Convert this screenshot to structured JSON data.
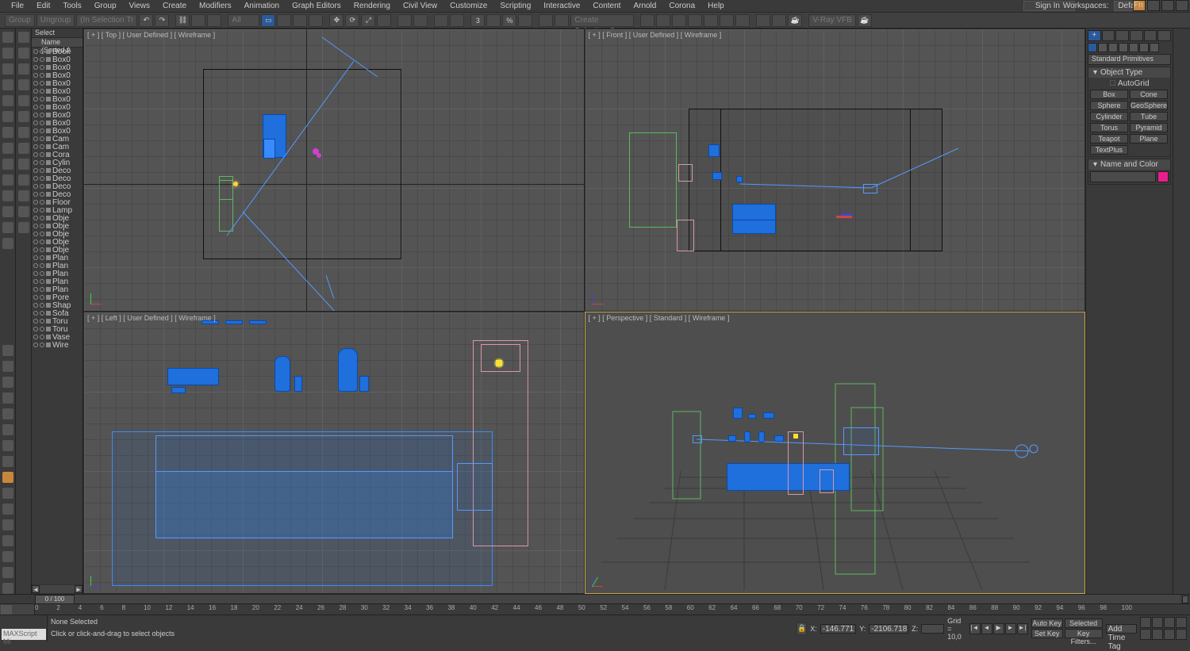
{
  "menu": {
    "items": [
      "File",
      "Edit",
      "Tools",
      "Group",
      "Views",
      "Create",
      "Modifiers",
      "Animation",
      "Graph Editors",
      "Rendering",
      "Civil View",
      "Customize",
      "Scripting",
      "Interactive",
      "Content",
      "Arnold",
      "Corona",
      "Help"
    ],
    "sign_in": "Sign In",
    "workspaces_label": "Workspaces:",
    "workspaces_value": "Default"
  },
  "toolbar": {
    "group": "Group",
    "ungroup": "Ungroup",
    "sel_hint": "(In Selection Tr",
    "all": "All",
    "create_set": "Create Selection Se",
    "vray": "V-Ray VFB"
  },
  "scene": {
    "head": "Select",
    "cols": "Name (Sorted A",
    "items": [
      "Book",
      "Box0",
      "Box0",
      "Box0",
      "Box0",
      "Box0",
      "Box0",
      "Box0",
      "Box0",
      "Box0",
      "Box0",
      "Cam",
      "Cam",
      "Cora",
      "Cylin",
      "Deco",
      "Deco",
      "Deco",
      "Deco",
      "Floor",
      "Lamp",
      "Obje",
      "Obje",
      "Obje",
      "Obje",
      "Obje",
      "Plan",
      "Plan",
      "Plan",
      "Plan",
      "Plan",
      "Pore",
      "Shap",
      "Sofa",
      "Toru",
      "Toru",
      "Vase",
      "Wire"
    ]
  },
  "viewports": {
    "top": "[ + ] [ Top ] [ User Defined ] [ Wireframe ]",
    "front": "[ + ] [ Front ] [ User Defined ] [ Wireframe ]",
    "left": "[ + ] [ Left ] [ User Defined ] [ Wireframe ]",
    "persp": "[ + ] [ Perspective ] [ Standard ] [ Wireframe ]"
  },
  "cmd": {
    "dropdown": "Standard Primitives",
    "sec1": "Object Type",
    "autogrid": "AutoGrid",
    "buttons": [
      "Box",
      "Cone",
      "Sphere",
      "GeoSphere",
      "Cylinder",
      "Tube",
      "Torus",
      "Pyramid",
      "Teapot",
      "Plane",
      "TextPlus"
    ],
    "sec2": "Name and Color"
  },
  "slider": {
    "pos": "0 / 100"
  },
  "ruler": {
    "ticks": [
      0,
      2,
      4,
      6,
      8,
      10,
      12,
      14,
      16,
      18,
      20,
      22,
      24,
      26,
      28,
      30,
      32,
      34,
      36,
      38,
      40,
      42,
      44,
      46,
      48,
      50,
      52,
      54,
      56,
      58,
      60,
      62,
      64,
      66,
      68,
      70,
      72,
      74,
      76,
      78,
      80,
      82,
      84,
      86,
      88,
      90,
      92,
      94,
      96,
      98,
      100
    ]
  },
  "status": {
    "none": "None Selected",
    "hint": "Click or click-and-drag to select objects",
    "maxscript": "MAXScript Mi",
    "x_label": "X:",
    "x": "-146.771",
    "y_label": "Y:",
    "y": "-2106.718",
    "z_label": "Z:",
    "z": "",
    "grid": "Grid = 10,0",
    "add_time": "Add Time Tag",
    "auto_key": "Auto Key",
    "set_key": "Set Key",
    "selected": "Selected",
    "key_filters": "Key Filters..."
  }
}
